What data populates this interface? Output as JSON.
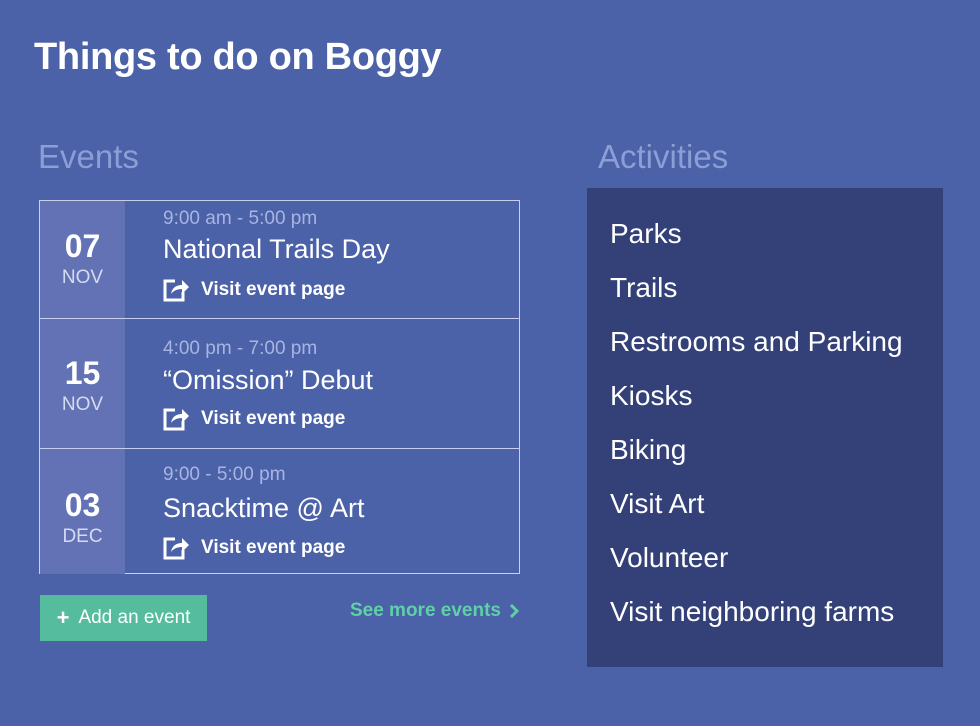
{
  "page": {
    "title": "Things to do on Boggy"
  },
  "events": {
    "heading": "Events",
    "items": [
      {
        "day": "07",
        "month": "NOV",
        "time": "9:00 am - 5:00 pm",
        "name": "National Trails Day",
        "link_label": "Visit event page"
      },
      {
        "day": "15",
        "month": "NOV",
        "time": "4:00 pm - 7:00 pm",
        "name": "“Omission” Debut",
        "link_label": "Visit event page"
      },
      {
        "day": "03",
        "month": "DEC",
        "time": "9:00 - 5:00 pm",
        "name": "Snacktime @ Art",
        "link_label": "Visit event page"
      }
    ],
    "add_button_label": "Add an event",
    "see_more_label": "See more events"
  },
  "activities": {
    "heading": "Activities",
    "items": [
      "Parks",
      "Trails",
      "Restrooms and Parking",
      "Kiosks",
      "Biking",
      "Visit Art",
      "Volunteer",
      "Visit neighboring farms"
    ]
  },
  "colors": {
    "background": "#4b61a8",
    "date_box": "#6272b4",
    "activities_panel": "#344178",
    "accent_green": "#55bd9d",
    "link_green": "#5fd0a7",
    "heading_muted": "#8c9ed6"
  },
  "icons": {
    "event_link": "share-external-icon",
    "add_button": "plus-icon",
    "see_more": "chevron-right-icon"
  }
}
